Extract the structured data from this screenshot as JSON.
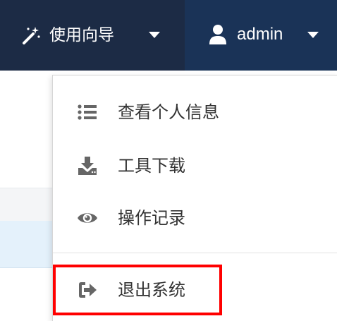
{
  "nav": {
    "wizard_label": "使用向导",
    "user_label": "admin"
  },
  "menu": {
    "items": [
      {
        "label": "查看个人信息",
        "icon": "list-icon"
      },
      {
        "label": "工具下载",
        "icon": "download-icon"
      },
      {
        "label": "操作记录",
        "icon": "eye-icon"
      },
      {
        "label": "退出系统",
        "icon": "sign-out-icon"
      }
    ]
  },
  "colors": {
    "topbar": "#1c2b45",
    "user_nav": "#1a3357",
    "highlight": "#ff0000",
    "icon": "#666666"
  }
}
